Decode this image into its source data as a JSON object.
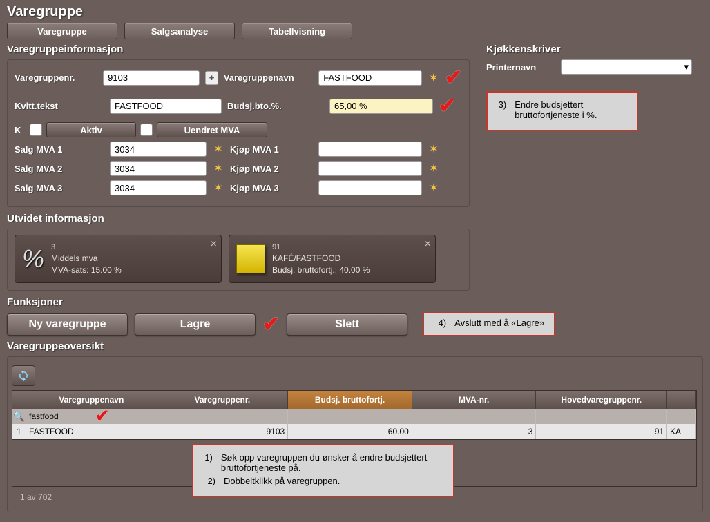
{
  "title": "Varegruppe",
  "tabs": [
    "Varegruppe",
    "Salgsanalyse",
    "Tabellvisning"
  ],
  "info": {
    "heading": "Varegruppeinformasjon",
    "nr_label": "Varegruppenr.",
    "nr_value": "9103",
    "kvitt_label": "Kvitt.tekst",
    "kvitt_value": "FASTFOOD",
    "navn_label": "Varegruppenavn",
    "navn_value": "FASTFOOD",
    "budsj_label": "Budsj.bto.%.",
    "budsj_value": "65,00 %",
    "aktiv_label": "Aktiv",
    "uendret_label": "Uendret MVA",
    "salg1_label": "Salg MVA 1",
    "salg2_label": "Salg MVA 2",
    "salg3_label": "Salg MVA 3",
    "salg_value": "3034",
    "kjop1_label": "Kjøp MVA 1",
    "kjop2_label": "Kjøp MVA 2",
    "kjop3_label": "Kjøp MVA 3"
  },
  "printer": {
    "heading": "Kjøkkenskriver",
    "label": "Printernavn",
    "value": ""
  },
  "utvidet": {
    "heading": "Utvidet informasjon",
    "card1_id": "3",
    "card1_name": "Middels mva",
    "card1_rate": "MVA-sats: 15.00 %",
    "card2_id": "91",
    "card2_name": "KAFÉ/FASTFOOD",
    "card2_rate": "Budsj. bruttofortj.: 40.00 %"
  },
  "funksjoner": {
    "heading": "Funksjoner",
    "new": "Ny varegruppe",
    "save": "Lagre",
    "delete": "Slett"
  },
  "notes": {
    "n1": "Søk opp varegruppen du ønsker å endre budsjettert bruttofortjeneste på.",
    "n2": "Dobbeltklikk på varegruppen.",
    "n3": "Endre budsjettert bruttofortjeneste i %.",
    "n4": "Avslutt med å «Lagre»"
  },
  "oversikt": {
    "heading": "Varegruppeoversikt",
    "cols": [
      "Varegruppenavn",
      "Varegruppenr.",
      "Budsj. bruttofortj.",
      "MVA-nr.",
      "Hovedvaregruppenr."
    ],
    "search": "fastfood",
    "row": {
      "idx": "1",
      "navn": "FASTFOOD",
      "nr": "9103",
      "budsj": "60.00",
      "mva": "3",
      "hoved": "91",
      "extra": "KA"
    },
    "footer": "1 av 702"
  }
}
